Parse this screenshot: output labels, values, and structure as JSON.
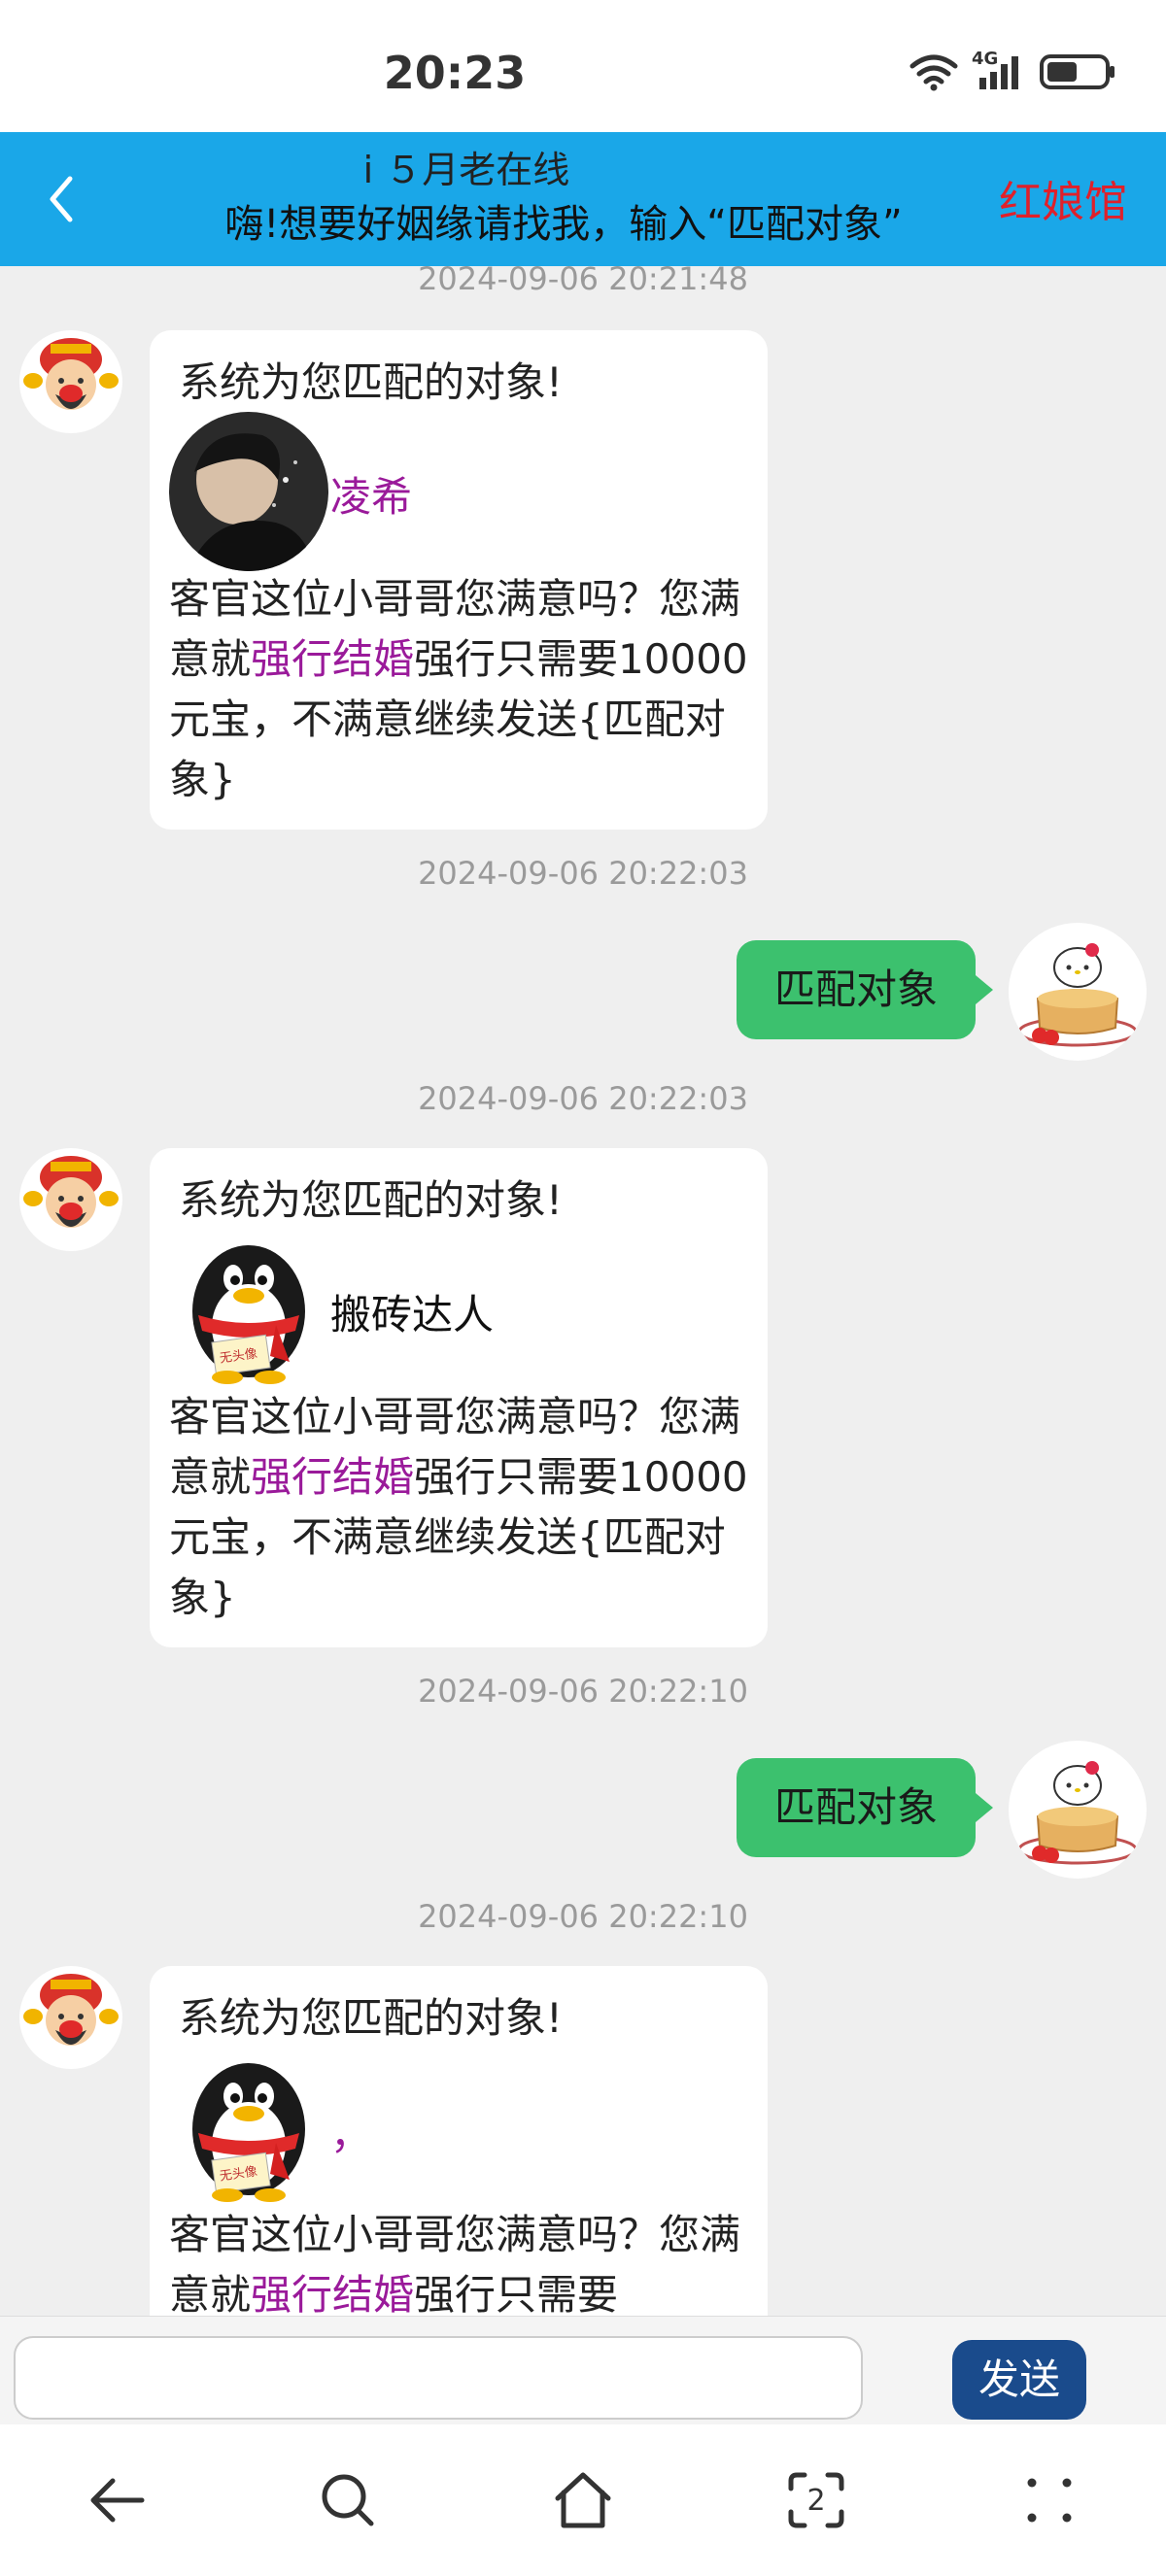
{
  "status_bar": {
    "time": "20:23",
    "network": "4G"
  },
  "header": {
    "title_line1": "i ５月老在线",
    "title_line2": "嗨!想要好姻缘请找我，输入“匹配对象”",
    "right_label": "红娘馆"
  },
  "messages": [
    {
      "timestamp": "2024-09-06 20:21:48",
      "title": "系统为您匹配的对象!",
      "match_name": "凌希",
      "match_avatar": "photo-avatar",
      "text_before": "客官这位小哥哥您满意吗？您满意就",
      "highlight": "强行结婚",
      "text_after": "强行只需要10000元宝，不满意继续发送{匹配对象}"
    },
    {
      "timestamp": "2024-09-06 20:22:03",
      "outgoing": "匹配对象"
    },
    {
      "timestamp": "2024-09-06 20:22:03",
      "title": "系统为您匹配的对象!",
      "match_name": "搬砖达人",
      "match_avatar": "penguin-no-avatar-icon",
      "no_avatar_label": "无头像",
      "text_before": "客官这位小哥哥您满意吗？您满意就",
      "highlight": "强行结婚",
      "text_after": "强行只需要10000元宝，不满意继续发送{匹配对象}"
    },
    {
      "timestamp": "2024-09-06 20:22:10",
      "outgoing": "匹配对象"
    },
    {
      "timestamp": "2024-09-06 20:22:10",
      "title": "系统为您匹配的对象!",
      "match_name": "，",
      "match_avatar": "penguin-no-avatar-icon",
      "no_avatar_label": "无头像",
      "text_before": "客官这位小哥哥您满意吗？您满意就",
      "highlight": "强行结婚",
      "text_after": "强行只需要"
    }
  ],
  "input": {
    "value": "",
    "placeholder": ""
  },
  "send_label": "发送",
  "nav": [
    "back-icon",
    "search-icon",
    "home-icon",
    "tabs-icon",
    "menu-icon"
  ],
  "nav_tabs_count": "2",
  "colors": {
    "header": "#1aa7e8",
    "outgoing_bubble": "#3cc16e",
    "send_button": "#1a4b8c",
    "highlight": "#9a1a9a",
    "header_right": "#e0202a"
  }
}
